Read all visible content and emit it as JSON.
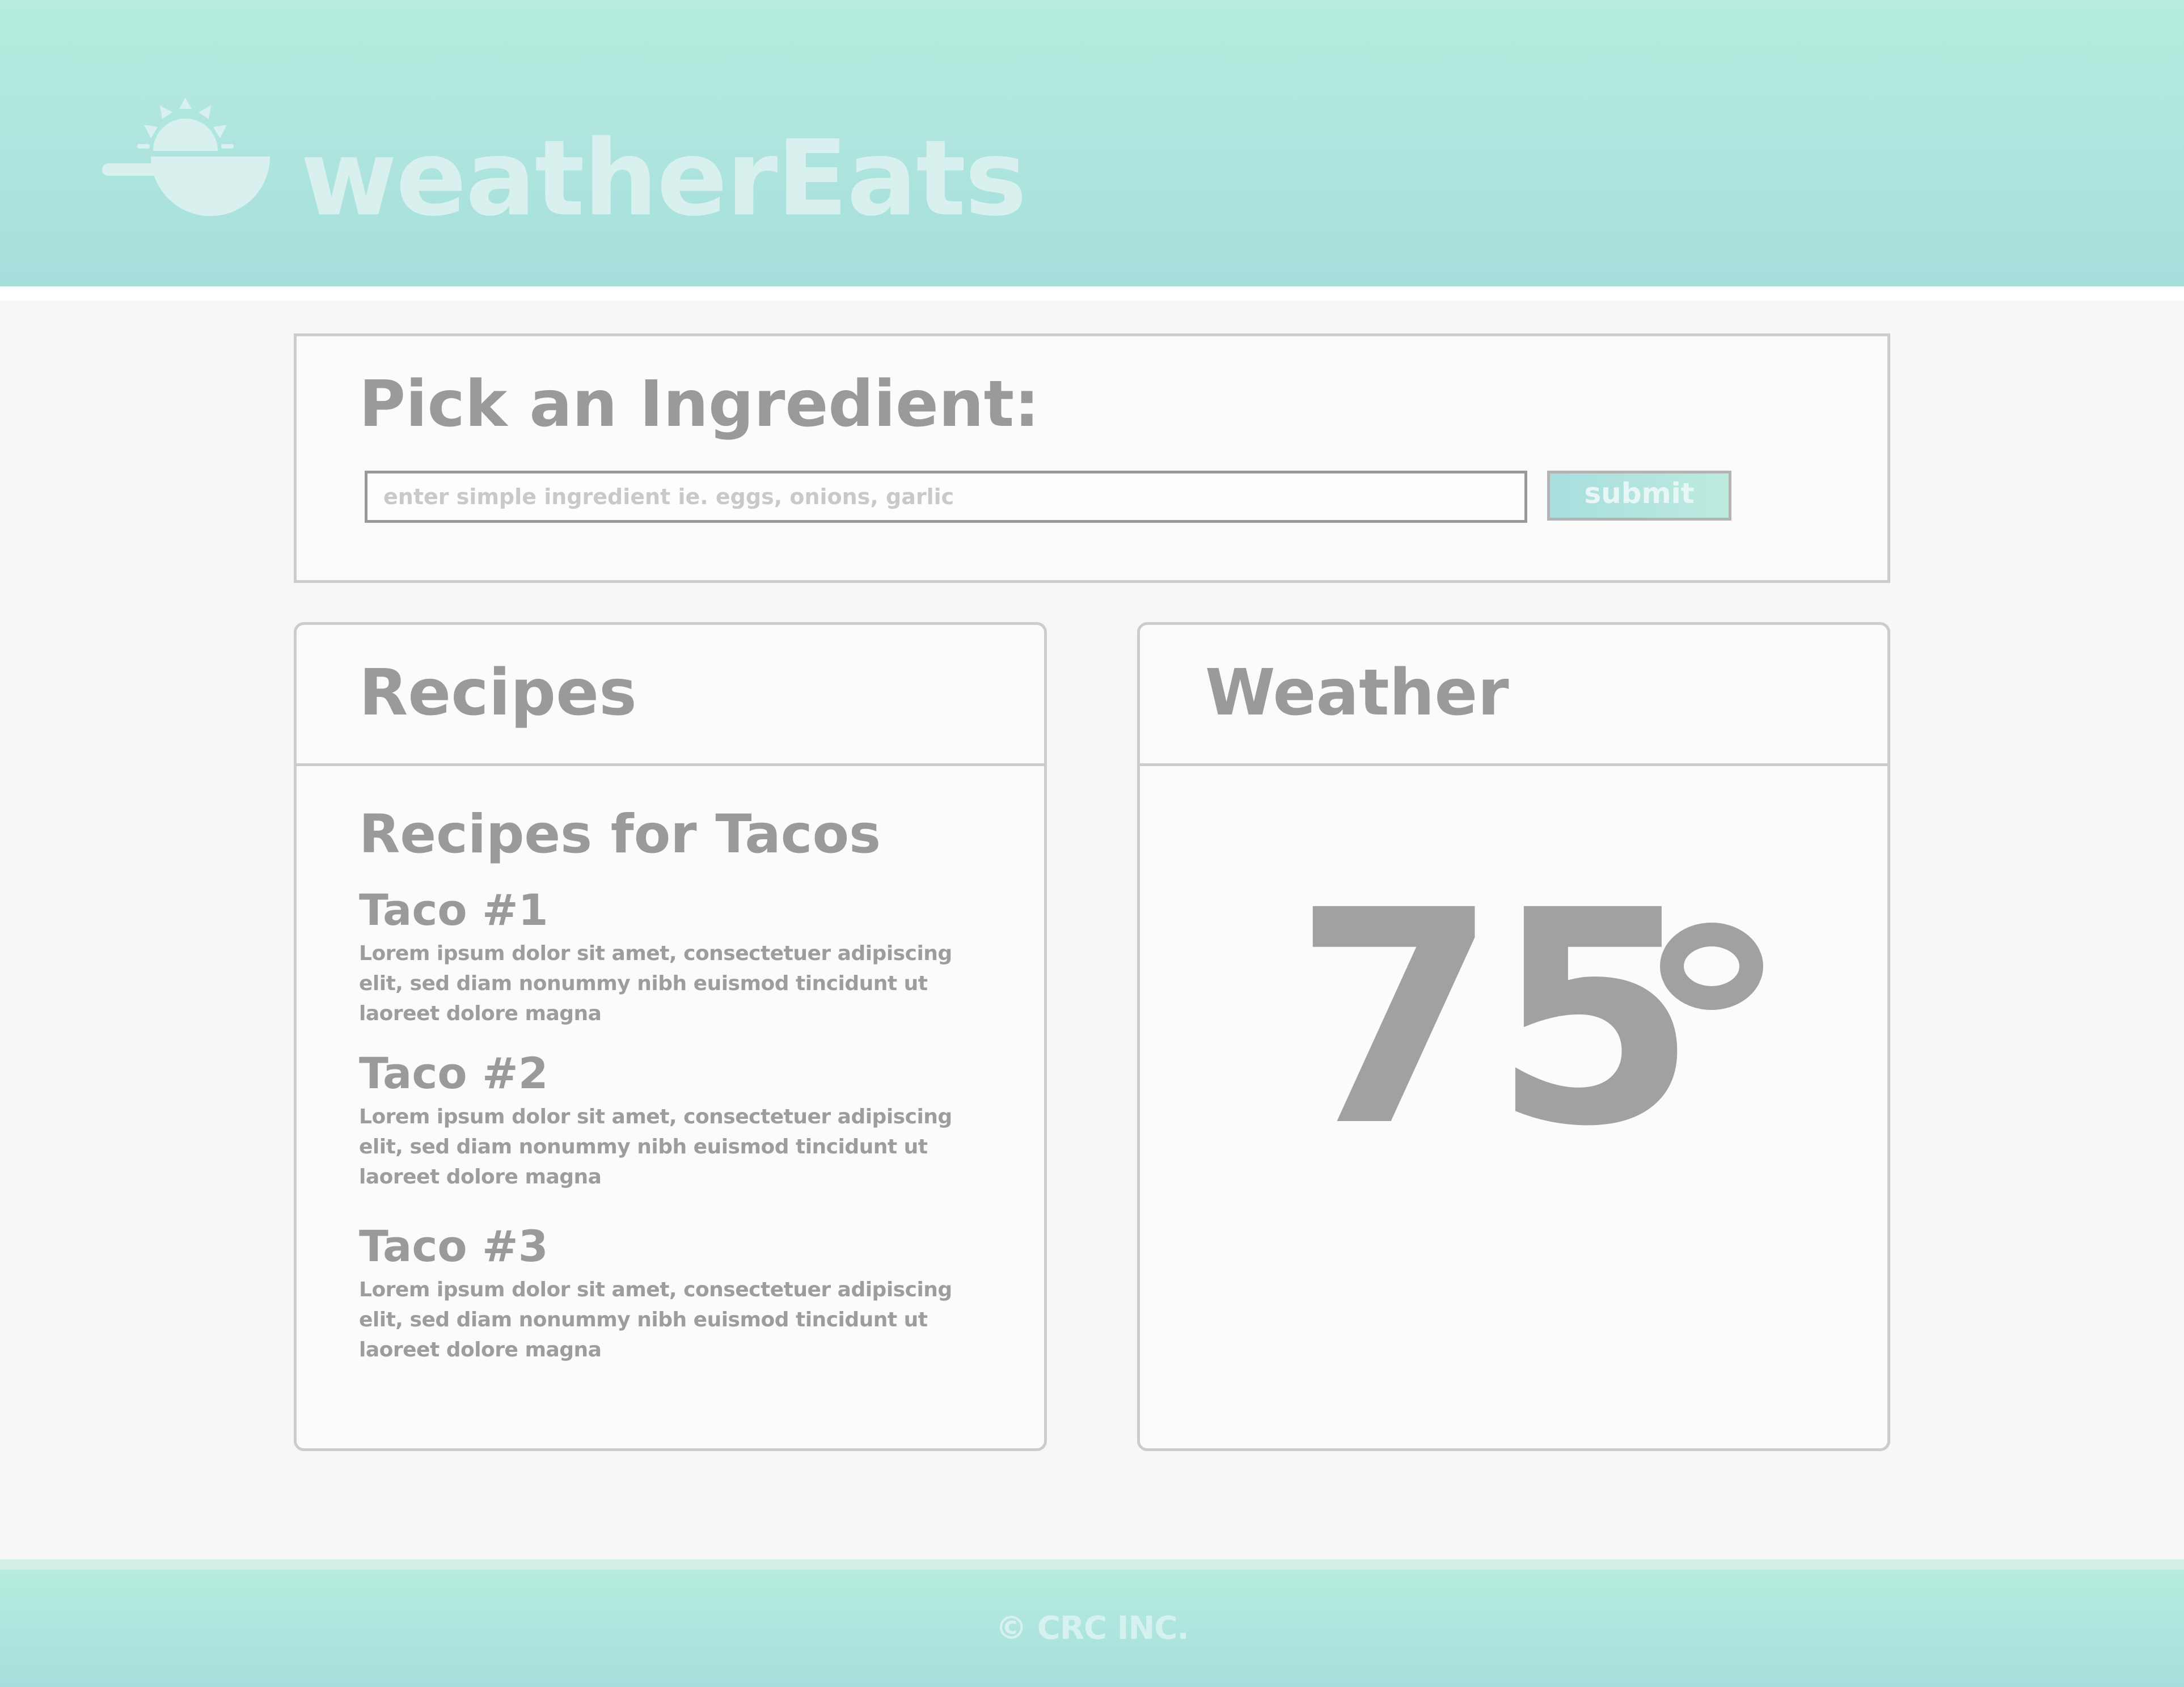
{
  "header": {
    "app_name": "weatherEats",
    "logo_icon": "bowl-with-rising-sun-icon"
  },
  "ingredient": {
    "title": "Pick an Ingredient:",
    "input_value": "",
    "input_placeholder": "enter simple ingredient ie. eggs, onions, garlic",
    "submit_label": "submit"
  },
  "recipes": {
    "title": "Recipes",
    "heading": "Recipes for Tacos",
    "items": [
      {
        "name": "Taco #1",
        "description": "Lorem ipsum dolor sit amet, consectetuer adipiscing elit, sed diam nonummy nibh euismod tincidunt ut laoreet dolore magna"
      },
      {
        "name": "Taco #2",
        "description": "Lorem ipsum dolor sit amet, consectetuer adipiscing elit, sed diam nonummy nibh euismod tincidunt ut laoreet dolore magna"
      },
      {
        "name": "Taco #3",
        "description": "Lorem ipsum dolor sit amet, consectetuer adipiscing elit, sed diam nonummy nibh euismod tincidunt ut laoreet dolore magna"
      }
    ]
  },
  "weather": {
    "title": "Weather",
    "temperature": "75",
    "unit_icon": "degree-symbol"
  },
  "footer": {
    "copyright": "© CRC INC."
  },
  "colors": {
    "header_gradient_top": "#b7ecdf",
    "header_gradient_bottom": "#a6dedc",
    "logo": "#d8f1ef",
    "text_gray": "#9a9a9a",
    "border_gray": "#cccccc",
    "page_background": "#f7f7f7",
    "panel_background": "#fbfbfb"
  }
}
